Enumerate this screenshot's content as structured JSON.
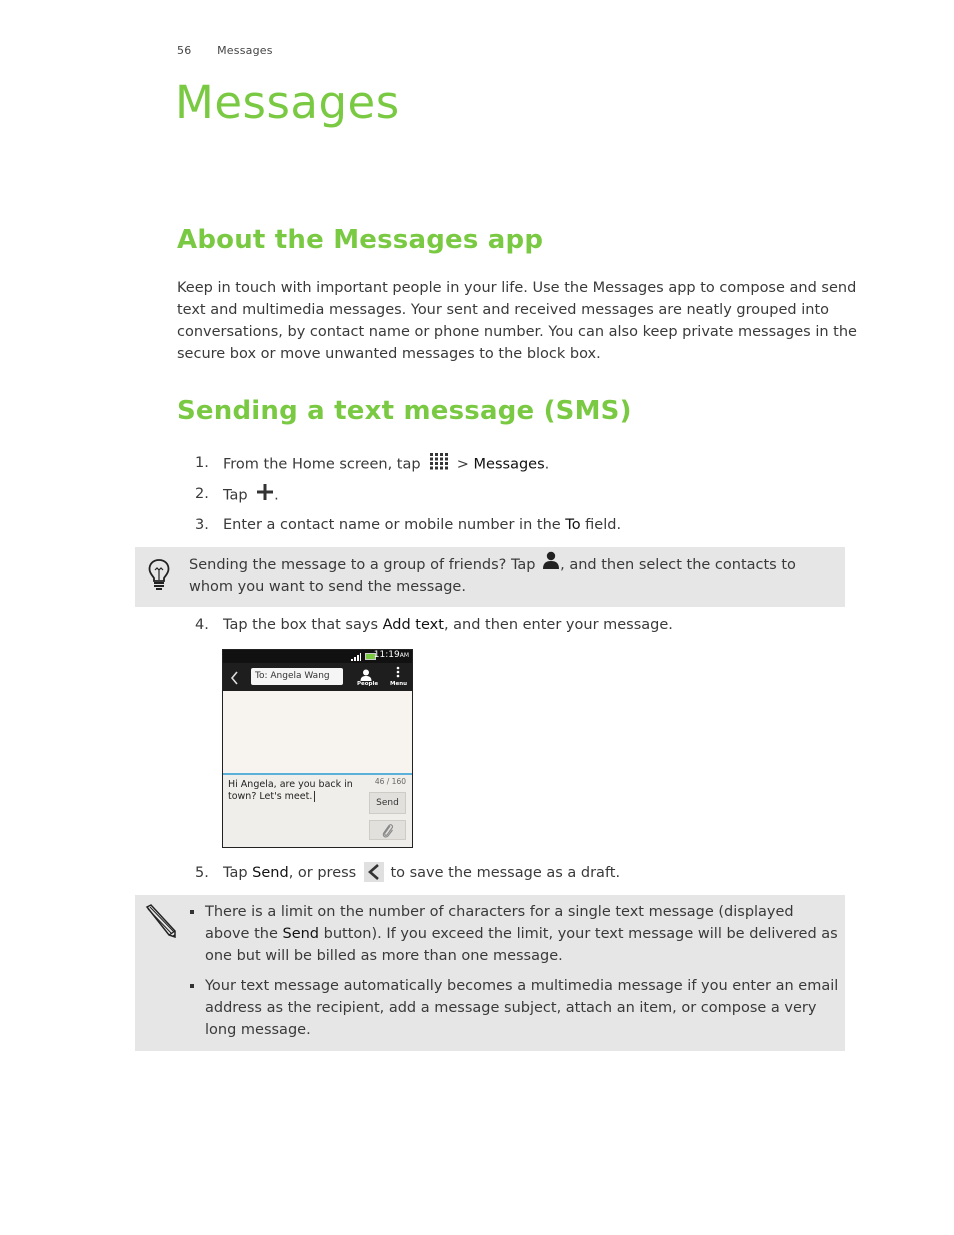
{
  "running_header": {
    "page_number": "56",
    "section": "Messages"
  },
  "chapter_title": "Messages",
  "about": {
    "heading": "About the Messages app",
    "body": "Keep in touch with important people in your life. Use the Messages app to compose and send text and multimedia messages. Your sent and received messages are neatly grouped into conversations, by contact name or phone number. You can also keep private messages in the secure box or move unwanted messages to the block box."
  },
  "sending": {
    "heading": "Sending a text message (SMS)",
    "steps": [
      {
        "num": "1.",
        "pre": "From the Home screen, tap",
        "icon": "all-apps-grid-icon",
        "mid": " > ",
        "bold": "Messages",
        "post": "."
      },
      {
        "num": "2.",
        "pre": "Tap",
        "icon": "plus-icon",
        "post": "."
      },
      {
        "num": "3.",
        "pre": "Enter a contact name or mobile number in the ",
        "bold": "To",
        "post": " field."
      },
      {
        "num": "4.",
        "pre": "Tap the box that says ",
        "bold": "Add text",
        "post": ", and then enter your message."
      },
      {
        "num": "5.",
        "pre": "Tap ",
        "bold": "Send",
        "mid": ", or press",
        "icon": "back-chevron-icon",
        "post": " to save the message as a draft."
      }
    ],
    "tip": {
      "icon": "lightbulb-icon",
      "pre": "Sending the message to a group of friends? Tap",
      "inline_icon": "person-icon",
      "post": ", and then select the contacts to whom you want to send the message."
    },
    "note": {
      "icon": "pencil-icon",
      "items": [
        {
          "pre": "There is a limit on the number of characters for a single text message (displayed above the ",
          "bold": "Send",
          "post": " button). If you exceed the limit, your text message will be delivered as one but will be billed as more than one message."
        },
        {
          "text": "Your text message automatically becomes a multimedia message if you enter an email address as the recipient, add a message subject, attach an item, or compose a very long message."
        }
      ]
    }
  },
  "phone_screenshot": {
    "status_time": "11:19",
    "status_ampm": "AM",
    "to_field": "To: Angela Wang",
    "people_label": "People",
    "menu_label": "Menu",
    "message_text": "Hi Angela,  are you back in town? Let's meet.",
    "char_counter": "46 / 160",
    "send_label": "Send",
    "colors": {
      "accent": "#5ab0d8",
      "battery": "#7ac943"
    }
  },
  "colors": {
    "heading_green": "#7ac943",
    "callout_bg": "#e6e6e6"
  }
}
